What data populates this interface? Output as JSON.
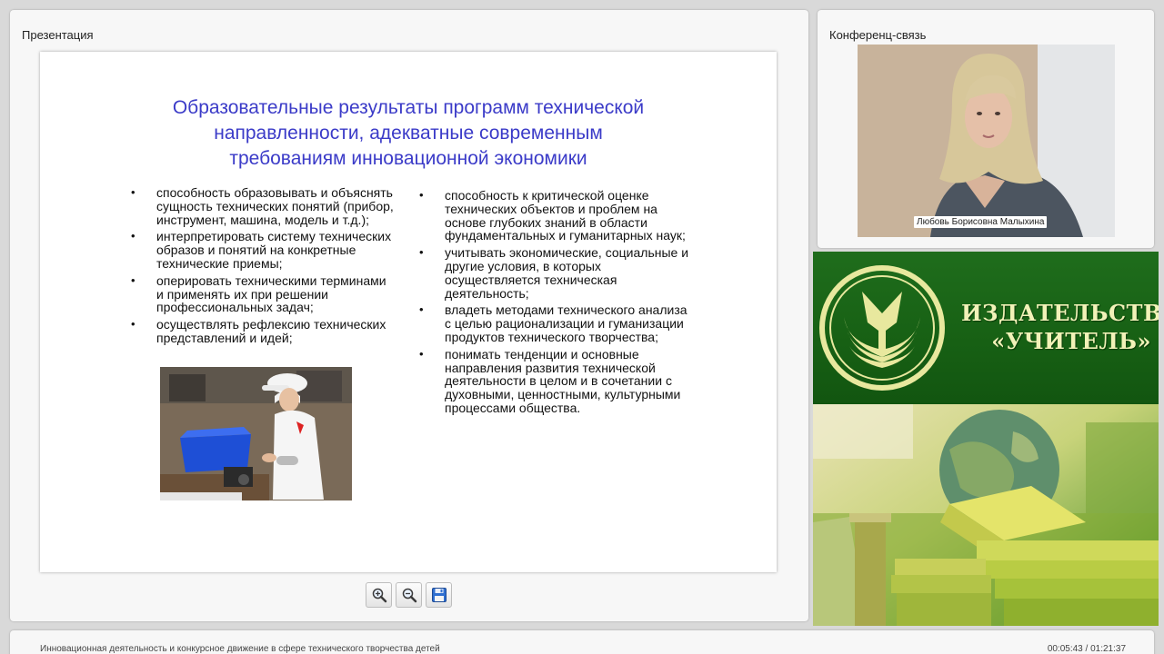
{
  "presentation": {
    "panel_title": "Презентация",
    "slide": {
      "title_lines": [
        "Образовательные результаты программ технической",
        "направленности, адекватные современным",
        "требованиям инновационной экономики"
      ],
      "left_items": [
        "способность образовывать и объяснять сущность технических понятий (прибор, инструмент, машина, модель и т.д.);",
        "интерпретировать систему технических образов и понятий на конкретные технические приемы;",
        "оперировать техническими терминами и применять их при решении профессиональных задач;",
        "осуществлять рефлексию технических представлений и идей;"
      ],
      "right_items": [
        "способность к критической оценке технических объектов и проблем на основе глубоких знаний в области фундаментальных и гуманитарных наук;",
        "учитывать экономические, социальные и другие условия, в которых осуществляется техническая деятельность;",
        "владеть методами технического анализа с целью рационализации и гуманизации продуктов технического творчества;",
        "понимать тенденции и основные направления развития технической деятельности в целом и в сочетании с духовными, ценностными, культурными процессами общества."
      ]
    },
    "toolbar": {
      "zoom_in_icon": "zoom-in-icon",
      "zoom_out_icon": "zoom-out-icon",
      "save_icon": "floppy-disk-icon"
    }
  },
  "conference": {
    "panel_title": "Конференц-связь",
    "speaker_name": "Любовь Борисовна Малыхина"
  },
  "publisher": {
    "name_line1": "ИЗДАТЕЛЬСТВО",
    "name_line2": "«УЧИТЕЛЬ»",
    "brand_green": "#176014",
    "text_cream": "#f2f2b8"
  },
  "footer": {
    "course_title": "Инновационная деятельность и конкурсное движение в сфере технического творчества детей",
    "time_display": "00:05:43 / 01:21:37"
  }
}
